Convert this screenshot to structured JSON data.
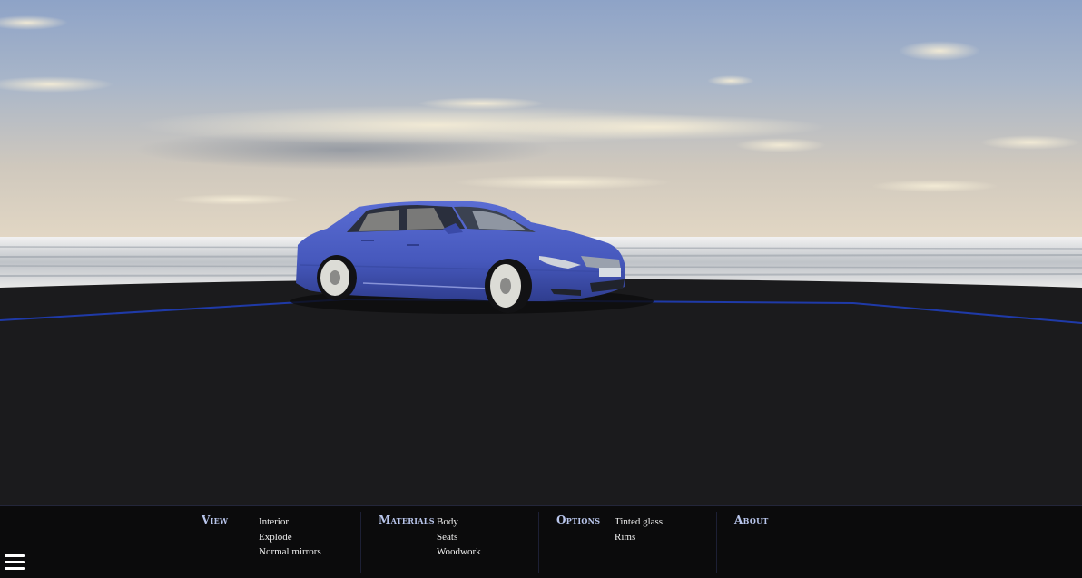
{
  "menu": {
    "view": {
      "heading": "View",
      "items": [
        "Interior",
        "Explode",
        "Normal mirrors"
      ]
    },
    "materials": {
      "heading": "Materials",
      "items": [
        "Body",
        "Seats",
        "Woodwork"
      ]
    },
    "options": {
      "heading": "Options",
      "items": [
        "Tinted glass",
        "Rims"
      ]
    },
    "about": {
      "heading": "About"
    }
  },
  "colors": {
    "car_body": "#4a5cc4",
    "floor": "#1b1b1d",
    "menu_bg": "#0b0b0c",
    "heading": "#b9c6ec",
    "floor_line": "#1f3aa8"
  },
  "icons": {
    "menu": "hamburger-menu-icon"
  }
}
